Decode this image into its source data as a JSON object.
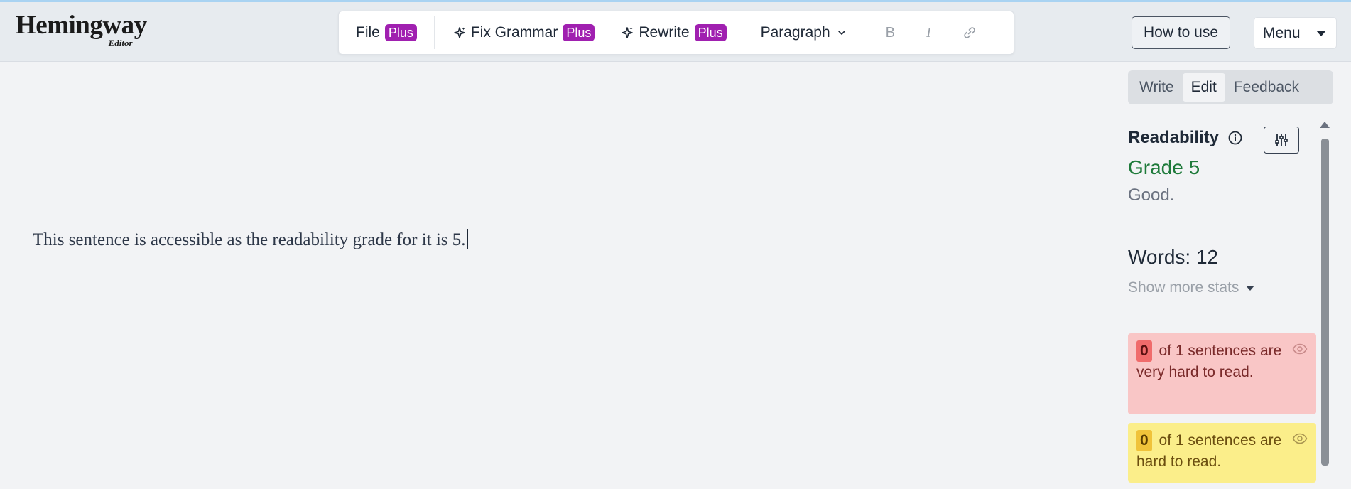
{
  "app": {
    "logo_main": "Hemingway",
    "logo_sub": "Editor"
  },
  "toolbar": {
    "file_label": "File",
    "file_badge": "Plus",
    "fix_grammar_label": "Fix Grammar",
    "fix_grammar_badge": "Plus",
    "rewrite_label": "Rewrite",
    "rewrite_badge": "Plus",
    "paragraph_label": "Paragraph",
    "bold_label": "B",
    "italic_label": "I",
    "icons": [
      "sparkle-icon",
      "chevron-down-icon",
      "link-icon"
    ]
  },
  "header": {
    "how_to_use_label": "How to use",
    "menu_label": "Menu"
  },
  "editor": {
    "text": "This sentence is accessible as the readability grade for it is 5."
  },
  "modes": {
    "items": [
      "Write",
      "Edit",
      "Feedback"
    ],
    "active": "Edit"
  },
  "sidebar": {
    "readability_title": "Readability",
    "grade": "Grade 5",
    "grade_desc": "Good.",
    "words": "Words: 12",
    "show_more": "Show more stats",
    "cards": [
      {
        "count": "0",
        "text": "of 1 sentences are very hard to read."
      },
      {
        "count": "0",
        "text": "of 1 sentences are hard to read."
      }
    ]
  },
  "colors": {
    "grade_good": "#1e7a3a",
    "badge": "#a020b0",
    "very_hard_bg": "#f9c6c6",
    "hard_bg": "#fbee8a"
  }
}
